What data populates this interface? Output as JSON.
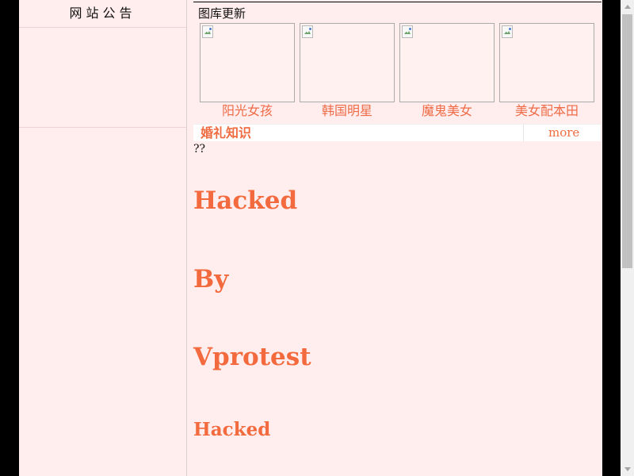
{
  "sidebar": {
    "notice_title": "网站公告"
  },
  "gallery": {
    "title": "图库更新",
    "items": [
      {
        "caption": "阳光女孩"
      },
      {
        "caption": "韩国明星"
      },
      {
        "caption": "魔鬼美女"
      },
      {
        "caption": "美女配本田"
      }
    ]
  },
  "wedding_section": {
    "title": "婚礼知识",
    "more_label": "more"
  },
  "content": {
    "placeholder": "??",
    "lines": [
      "Hacked",
      "By",
      "Vprotest",
      "Hacked"
    ]
  },
  "colors": {
    "page_background": "#ffeeed",
    "accent": "#f26a3d",
    "outer_background": "#000000"
  },
  "icons": {
    "image": "broken-image-icon",
    "scroll_up": "chevron-up-icon",
    "scroll_down": "chevron-down-icon"
  }
}
